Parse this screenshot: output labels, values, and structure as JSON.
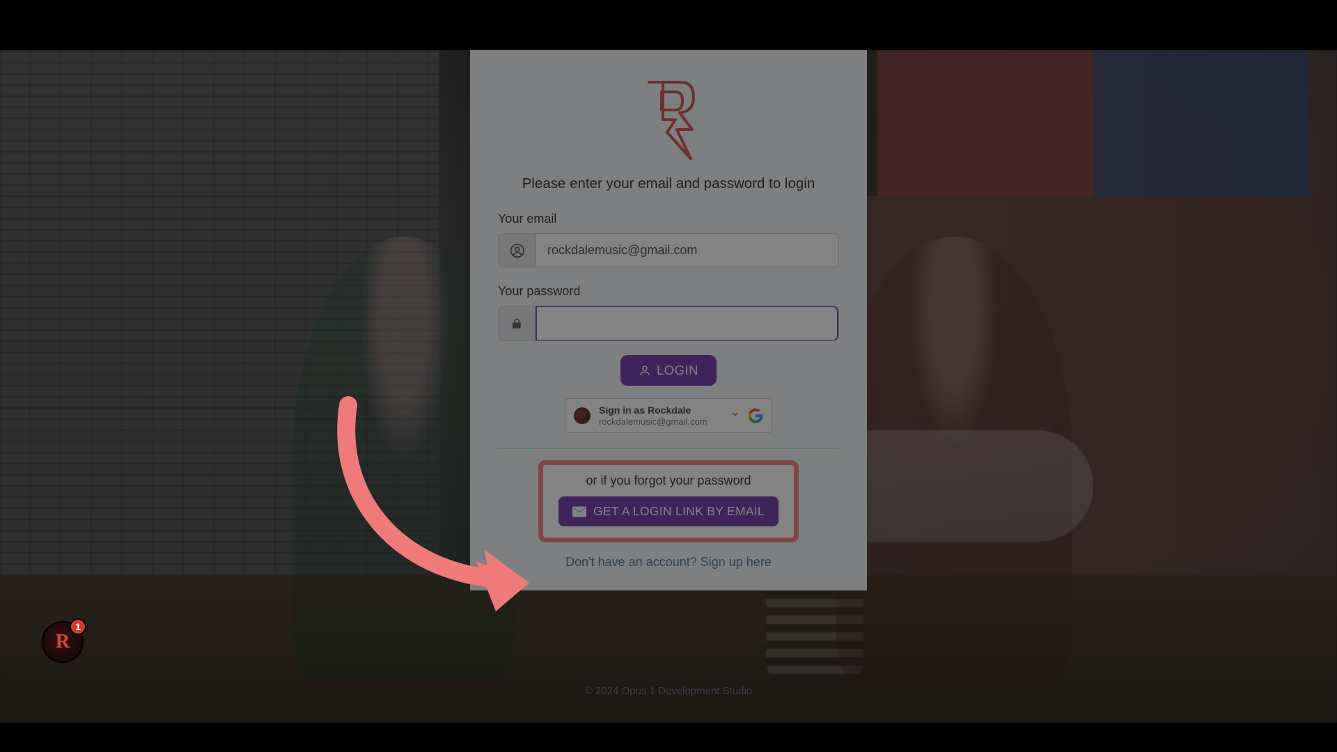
{
  "brand": {
    "logo_letter": "R",
    "logo_color": "#cd4b43"
  },
  "prompt": "Please enter your email and password to login",
  "email": {
    "label": "Your email",
    "value": "rockdalemusic@gmail.com"
  },
  "password": {
    "label": "Your password",
    "value": ""
  },
  "login_button": "LOGIN",
  "google_signin": {
    "line1": "Sign in as Rockdale",
    "line2": "rockdalemusic@gmail.com"
  },
  "forgot": {
    "text": "or if you forgot your password",
    "button": "GET A LOGIN LINK BY EMAIL"
  },
  "signup_link": "Don't have an account? Sign up here",
  "footer": "© 2024 Opus 1 Development Studio",
  "corner_badge": {
    "letter": "R",
    "count": "1"
  },
  "colors": {
    "primary": "#6a2da3",
    "highlight_border": "#ef7a79",
    "link": "#4a6a8a"
  }
}
